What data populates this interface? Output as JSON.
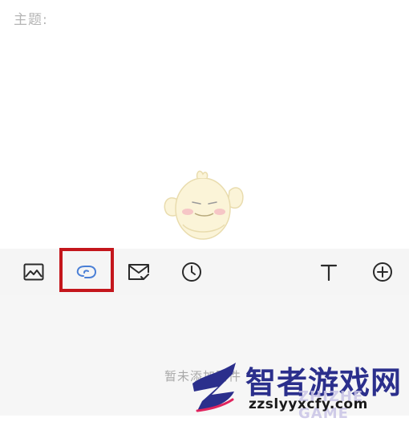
{
  "compose": {
    "subject_label": "主题:",
    "subject_value": ""
  },
  "toolbar": {
    "items": [
      {
        "icon": "image-icon"
      },
      {
        "icon": "link-icon",
        "highlighted": true,
        "icon_color": "#4a7fd6"
      },
      {
        "icon": "mail-check-icon"
      },
      {
        "icon": "clock-icon"
      },
      {
        "icon": "text-format-icon"
      },
      {
        "icon": "add-icon"
      }
    ],
    "highlight_color": "#c4161c"
  },
  "attachments": {
    "empty_text": "暂未添加附件"
  },
  "watermark": {
    "title": "智者游戏网",
    "english": "ZHIZHE GAME",
    "url": "zzslyyxcfy.com"
  }
}
